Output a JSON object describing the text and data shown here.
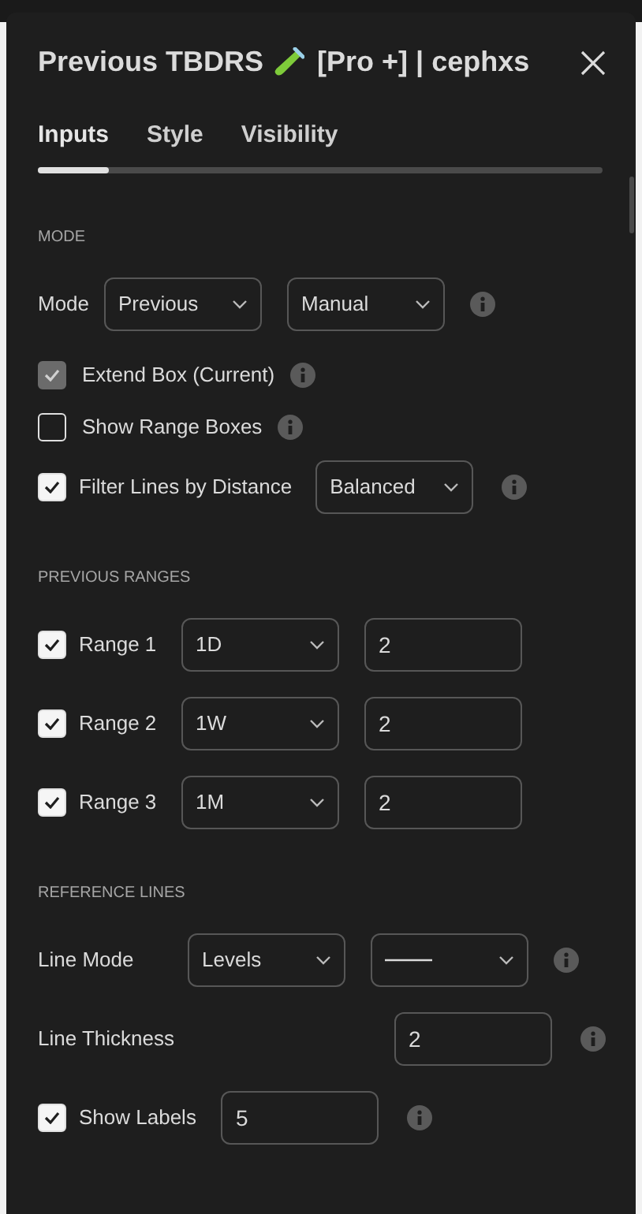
{
  "dialog": {
    "title": "Previous TBDRS",
    "title_suffix": "[Pro +] | cephxs"
  },
  "tabs": [
    {
      "label": "Inputs",
      "selected": true
    },
    {
      "label": "Style",
      "selected": false
    },
    {
      "label": "Visibility",
      "selected": false
    }
  ],
  "sections": [
    {
      "heading": "MODE",
      "rows": [
        {
          "kind": "select-pair",
          "label": "Mode",
          "selects": [
            {
              "value": "Previous"
            },
            {
              "value": "Manual"
            }
          ],
          "info": true
        },
        {
          "kind": "check",
          "label": "Extend Box (Current)",
          "checked": true,
          "disabled": true,
          "info": true
        },
        {
          "kind": "check",
          "label": "Show Range Boxes",
          "checked": false,
          "disabled": false,
          "info": true
        },
        {
          "kind": "check-select",
          "label": "Filter Lines by Distance",
          "checked": true,
          "disabled": false,
          "select": "Balanced",
          "info": true
        }
      ]
    },
    {
      "heading": "PREVIOUS RANGES",
      "rows": [
        {
          "kind": "check-select-input",
          "label": "Range 1",
          "checked": true,
          "disabled": false,
          "select": "1D",
          "input": "2",
          "info": false
        },
        {
          "kind": "check-select-input",
          "label": "Range 2",
          "checked": true,
          "disabled": false,
          "select": "1W",
          "input": "2",
          "info": false
        },
        {
          "kind": "check-select-input",
          "label": "Range 3",
          "checked": true,
          "disabled": false,
          "select": "1M",
          "input": "2",
          "info": false
        }
      ]
    },
    {
      "heading": "REFERENCE LINES",
      "rows": [
        {
          "kind": "select-pair",
          "label": "Line Mode",
          "selects": [
            {
              "value": "Levels"
            },
            {
              "kind": "line"
            }
          ],
          "info": true
        },
        {
          "kind": "input",
          "label": "Line Thickness",
          "input": "2",
          "info": true
        },
        {
          "kind": "check-input",
          "label": "Show Labels",
          "checked": true,
          "disabled": false,
          "input": "5",
          "info": true
        }
      ]
    }
  ]
}
